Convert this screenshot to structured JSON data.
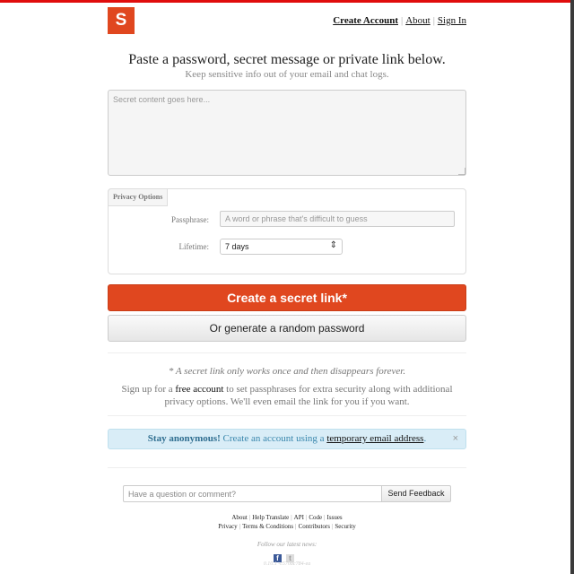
{
  "brand": {
    "logo_letter": "S",
    "accent": "#e0471f"
  },
  "nav": {
    "create_account": "Create Account",
    "about": "About",
    "sign_in": "Sign In",
    "separator": "|"
  },
  "hero": {
    "title": "Paste a password, secret message or private link below.",
    "subtitle": "Keep sensitive info out of your email and chat logs."
  },
  "secret_input": {
    "placeholder": "Secret content goes here..."
  },
  "privacy": {
    "legend": "Privacy Options",
    "passphrase_label": "Passphrase:",
    "passphrase_placeholder": "A word or phrase that's difficult to guess",
    "lifetime_label": "Lifetime:",
    "lifetime_value": "7 days"
  },
  "actions": {
    "primary": "Create a secret link*",
    "secondary": "Or generate a random password"
  },
  "info": {
    "note": "* A secret link only works once and then disappears forever.",
    "signup_pre": "Sign up for a ",
    "signup_link": "free account",
    "signup_post": " to set passphrases for extra security along with additional privacy options. We'll even email the link for you if you want."
  },
  "alert": {
    "strong": "Stay anonymous!",
    "text": " Create an account using a ",
    "link": "temporary email address",
    "end": ".",
    "close": "×",
    "bg": "#d9edf7"
  },
  "feedback": {
    "placeholder": "Have a question or comment?",
    "button": "Send Feedback"
  },
  "footer": {
    "row1": [
      "About",
      "Help Translate",
      "API",
      "Code",
      "Issues"
    ],
    "row2": [
      "Privacy",
      "Terms & Conditions",
      "Contributors",
      "Security"
    ],
    "follow": "Follow our latest news:",
    "version": "0.10.1 -c5708c784-ea"
  }
}
